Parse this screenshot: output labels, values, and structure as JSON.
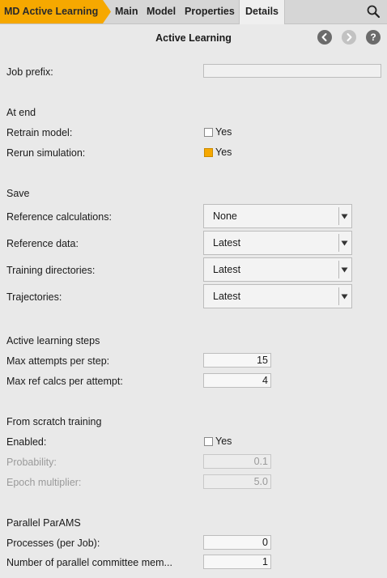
{
  "tabs": {
    "module": "MD Active Learning",
    "items": [
      "Main",
      "Model",
      "Properties",
      "Details"
    ]
  },
  "header": {
    "title": "Active Learning"
  },
  "colors": {
    "accent": "#f6a800",
    "nav_button": "#6b6b6b",
    "nav_button_disabled": "#bdbdbd"
  },
  "icons": {
    "search": "search-icon",
    "back": "chevron-left-icon",
    "forward": "chevron-right-icon",
    "help": "help-icon"
  },
  "help_glyph": "?",
  "job_prefix": {
    "label": "Job prefix:",
    "value": ""
  },
  "at_end": {
    "title": "At end",
    "retrain_model": {
      "label": "Retrain model:",
      "option": "Yes",
      "checked": false
    },
    "rerun_simulation": {
      "label": "Rerun simulation:",
      "option": "Yes",
      "checked": true
    }
  },
  "save": {
    "title": "Save",
    "reference_calculations": {
      "label": "Reference calculations:",
      "value": "None"
    },
    "reference_data": {
      "label": "Reference data:",
      "value": "Latest"
    },
    "training_directories": {
      "label": "Training directories:",
      "value": "Latest"
    },
    "trajectories": {
      "label": "Trajectories:",
      "value": "Latest"
    }
  },
  "active_learning_steps": {
    "title": "Active learning steps",
    "max_attempts": {
      "label": "Max attempts per step:",
      "value": "15"
    },
    "max_ref_calcs": {
      "label": "Max ref calcs per attempt:",
      "value": "4"
    }
  },
  "from_scratch": {
    "title": "From scratch training",
    "enabled": {
      "label": "Enabled:",
      "option": "Yes",
      "checked": false
    },
    "probability": {
      "label": "Probability:",
      "value": "0.1"
    },
    "epoch_multiplier": {
      "label": "Epoch multiplier:",
      "value": "5.0"
    }
  },
  "parallel": {
    "title": "Parallel ParAMS",
    "processes": {
      "label": "Processes (per Job):",
      "value": "0"
    },
    "committee": {
      "label": "Number of parallel committee mem...",
      "value": "1"
    }
  }
}
